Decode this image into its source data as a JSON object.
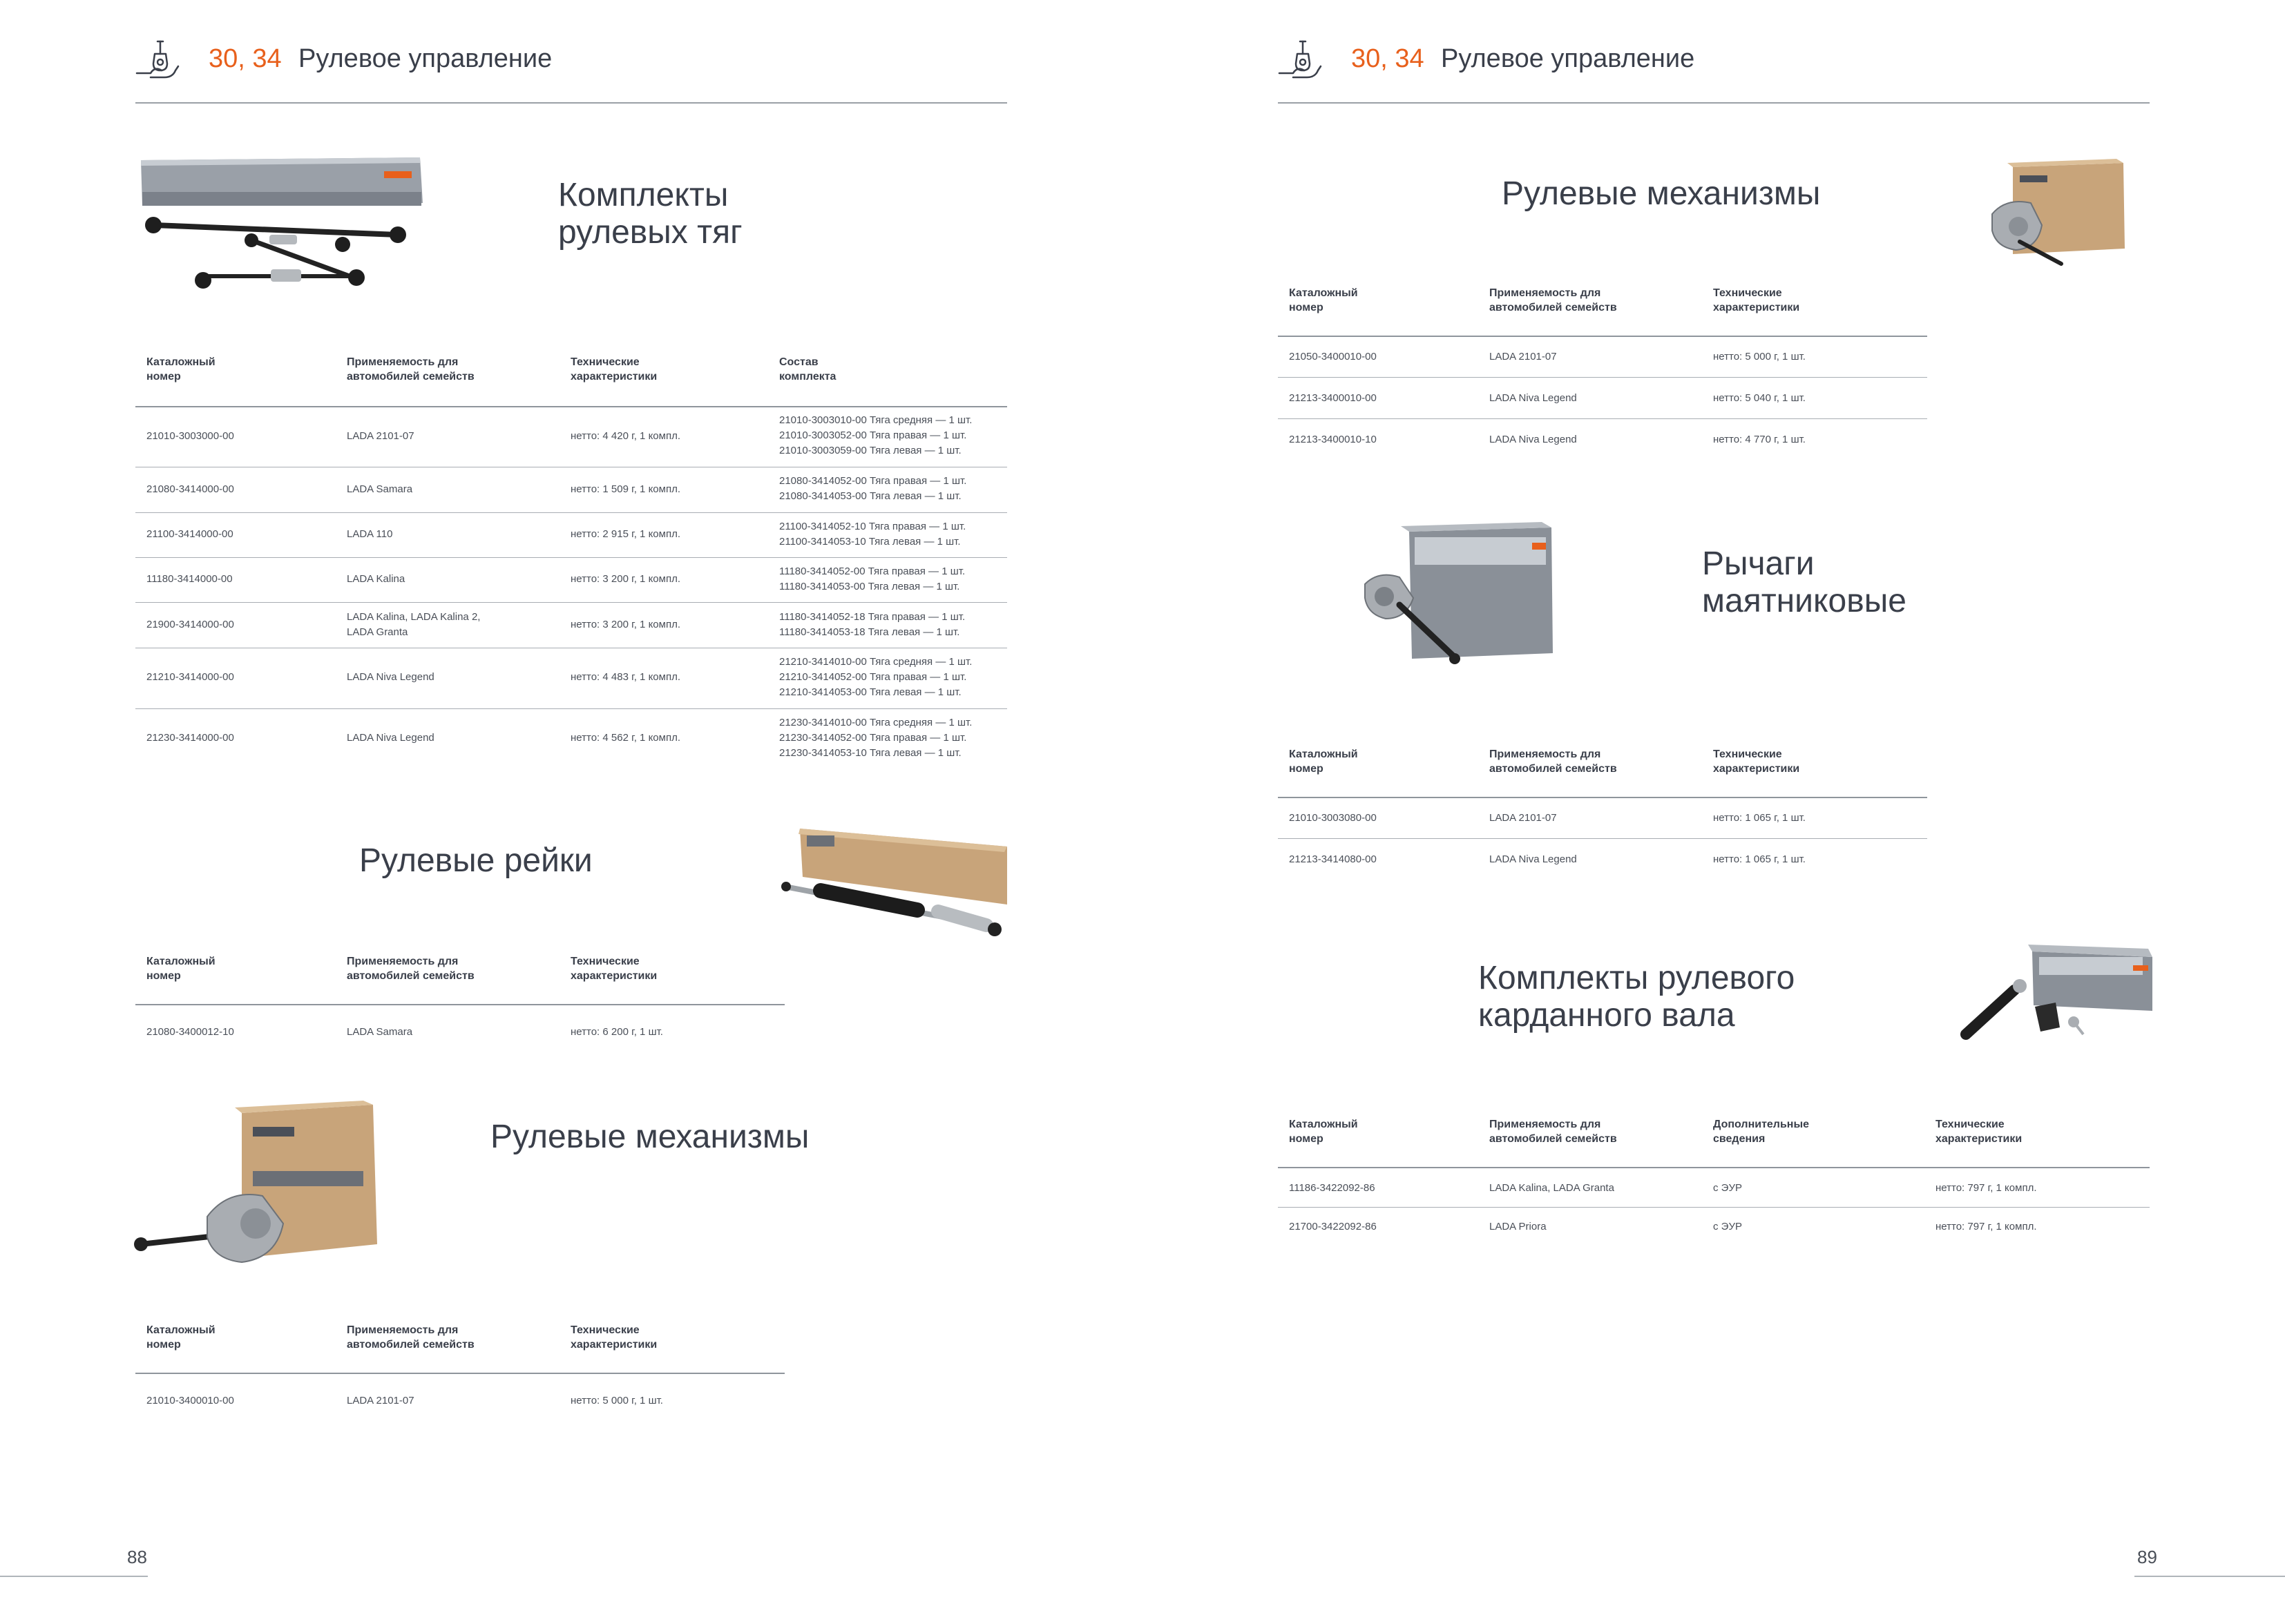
{
  "left_page": {
    "header": {
      "number": "30, 34",
      "title": "Рулевое управление"
    },
    "page_number": "88"
  },
  "right_page": {
    "header": {
      "number": "30, 34",
      "title": "Рулевое управление"
    },
    "page_number": "89"
  },
  "sections": {
    "tie_rod_kits": {
      "title_line1": "Комплекты",
      "title_line2": "рулевых тяг",
      "headers": {
        "c1a": "Каталожный",
        "c1b": "номер",
        "c2a": "Применяемость для",
        "c2b": "автомобилей семейств",
        "c3a": "Технические",
        "c3b": "характеристики",
        "c4a": "Состав",
        "c4b": "комплекта"
      },
      "rows": [
        {
          "catalog": "21010-3003000-00",
          "model": "LADA 2101-07",
          "model2": "",
          "spec": "нетто: 4 420 г, 1 компл.",
          "comp": [
            "21010-3003010-00 Тяга средняя — 1 шт.",
            "21010-3003052-00 Тяга правая — 1 шт.",
            "21010-3003059-00 Тяга левая — 1 шт."
          ]
        },
        {
          "catalog": "21080-3414000-00",
          "model": "LADA Samara",
          "model2": "",
          "spec": "нетто: 1 509 г, 1 компл.",
          "comp": [
            "21080-3414052-00 Тяга правая — 1 шт.",
            "21080-3414053-00 Тяга левая — 1 шт."
          ]
        },
        {
          "catalog": "21100-3414000-00",
          "model": "LADA 110",
          "model2": "",
          "spec": "нетто: 2 915 г, 1 компл.",
          "comp": [
            "21100-3414052-10 Тяга правая — 1 шт.",
            "21100-3414053-10 Тяга левая — 1 шт."
          ]
        },
        {
          "catalog": "11180-3414000-00",
          "model": "LADA Kalina",
          "model2": "",
          "spec": "нетто: 3 200 г, 1 компл.",
          "comp": [
            "11180-3414052-00 Тяга правая — 1 шт.",
            "11180-3414053-00 Тяга левая — 1 шт."
          ]
        },
        {
          "catalog": "21900-3414000-00",
          "model": "LADA Kalina, LADA Kalina 2,",
          "model2": "LADA Granta",
          "spec": "нетто: 3 200 г, 1 компл.",
          "comp": [
            "11180-3414052-18 Тяга правая — 1 шт.",
            "11180-3414053-18 Тяга левая — 1 шт."
          ]
        },
        {
          "catalog": "21210-3414000-00",
          "model": "LADA Niva Legend",
          "model2": "",
          "spec": "нетто: 4 483 г, 1 компл.",
          "comp": [
            "21210-3414010-00 Тяга средняя — 1 шт.",
            "21210-3414052-00 Тяга правая — 1 шт.",
            "21210-3414053-00 Тяга левая — 1 шт."
          ]
        },
        {
          "catalog": "21230-3414000-00",
          "model": "LADA Niva Legend",
          "model2": "",
          "spec": "нетто: 4 562 г, 1 компл.",
          "comp": [
            "21230-3414010-00 Тяга средняя — 1 шт.",
            "21230-3414052-00 Тяга правая — 1 шт.",
            "21230-3414053-10 Тяга левая — 1 шт."
          ]
        }
      ]
    },
    "steering_racks": {
      "title": "Рулевые рейки",
      "headers": {
        "c1a": "Каталожный",
        "c1b": "номер",
        "c2a": "Применяемость для",
        "c2b": "автомобилей семейств",
        "c3a": "Технические",
        "c3b": "характеристики"
      },
      "rows": [
        {
          "catalog": "21080-3400012-10",
          "model": "LADA Samara",
          "spec": "нетто: 6 200 г, 1 шт."
        }
      ]
    },
    "steering_gears_left": {
      "title": "Рулевые механизмы",
      "headers": {
        "c1a": "Каталожный",
        "c1b": "номер",
        "c2a": "Применяемость для",
        "c2b": "автомобилей семейств",
        "c3a": "Технические",
        "c3b": "характеристики"
      },
      "rows": [
        {
          "catalog": "21010-3400010-00",
          "model": "LADA 2101-07",
          "spec": "нетто: 5 000 г, 1 шт."
        }
      ]
    },
    "steering_gears_right": {
      "title": "Рулевые механизмы",
      "headers": {
        "c1a": "Каталожный",
        "c1b": "номер",
        "c2a": "Применяемость для",
        "c2b": "автомобилей семейств",
        "c3a": "Технические",
        "c3b": "характеристики"
      },
      "rows": [
        {
          "catalog": "21050-3400010-00",
          "model": "LADA 2101-07",
          "spec": "нетто: 5 000 г, 1 шт."
        },
        {
          "catalog": "21213-3400010-00",
          "model": "LADA Niva Legend",
          "spec": "нетто: 5 040 г, 1 шт."
        },
        {
          "catalog": "21213-3400010-10",
          "model": "LADA Niva Legend",
          "spec": "нетто: 4 770 г, 1 шт."
        }
      ]
    },
    "pendulum_arms": {
      "title_line1": "Рычаги",
      "title_line2": "маятниковые",
      "headers": {
        "c1a": "Каталожный",
        "c1b": "номер",
        "c2a": "Применяемость для",
        "c2b": "автомобилей семейств",
        "c3a": "Технические",
        "c3b": "характеристики"
      },
      "rows": [
        {
          "catalog": "21010-3003080-00",
          "model": "LADA 2101-07",
          "spec": "нетто: 1 065 г, 1 шт."
        },
        {
          "catalog": "21213-3414080-00",
          "model": "LADA Niva Legend",
          "spec": "нетто: 1 065 г, 1 шт."
        }
      ]
    },
    "cardan_shaft_kits": {
      "title_line1": "Комплекты рулевого",
      "title_line2": "карданного вала",
      "headers": {
        "c1a": "Каталожный",
        "c1b": "номер",
        "c2a": "Применяемость для",
        "c2b": "автомобилей семейств",
        "c3a": "Дополнительные",
        "c3b": "сведения",
        "c4a": "Технические",
        "c4b": "характеристики"
      },
      "rows": [
        {
          "catalog": "11186-3422092-86",
          "model": "LADA Kalina, LADA Granta",
          "info": "с ЭУР",
          "spec": "нетто: 797 г, 1 компл."
        },
        {
          "catalog": "21700-3422092-86",
          "model": "LADA Priora",
          "info": "с ЭУР",
          "spec": "нетто: 797 г, 1 компл."
        }
      ]
    }
  },
  "colors": {
    "accent": "#e8601c",
    "text": "#3a3f4a",
    "box_kraft": "#c8a47a",
    "box_grey": "#8a9098"
  },
  "icons": [
    "steering-tie-rod-icon"
  ]
}
